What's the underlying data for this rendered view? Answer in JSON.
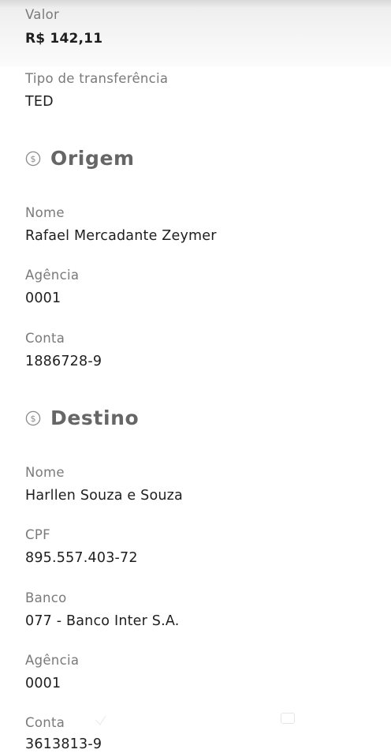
{
  "transfer": {
    "amount_label": "Valor",
    "amount": "R$ 142,11",
    "type_label": "Tipo de transferência",
    "type": "TED"
  },
  "origin": {
    "title": "Origem",
    "icon": "dollar-coin-icon",
    "name_label": "Nome",
    "name": "Rafael Mercadante Zeymer",
    "agency_label": "Agência",
    "agency": "0001",
    "account_label": "Conta",
    "account": "1886728-9"
  },
  "destination": {
    "title": "Destino",
    "icon": "dollar-coin-icon",
    "name_label": "Nome",
    "name": "Harllen Souza e Souza",
    "cpf_label": "CPF",
    "cpf": "895.557.403-72",
    "bank_label": "Banco",
    "bank": "077 - Banco Inter S.A.",
    "agency_label": "Agência",
    "agency": "0001",
    "account_label": "Conta",
    "account": "3613813-9"
  },
  "colors": {
    "label": "#7a7a7a",
    "value": "#1e1e1e",
    "section_title": "#666666",
    "header_band": "#ececec"
  }
}
